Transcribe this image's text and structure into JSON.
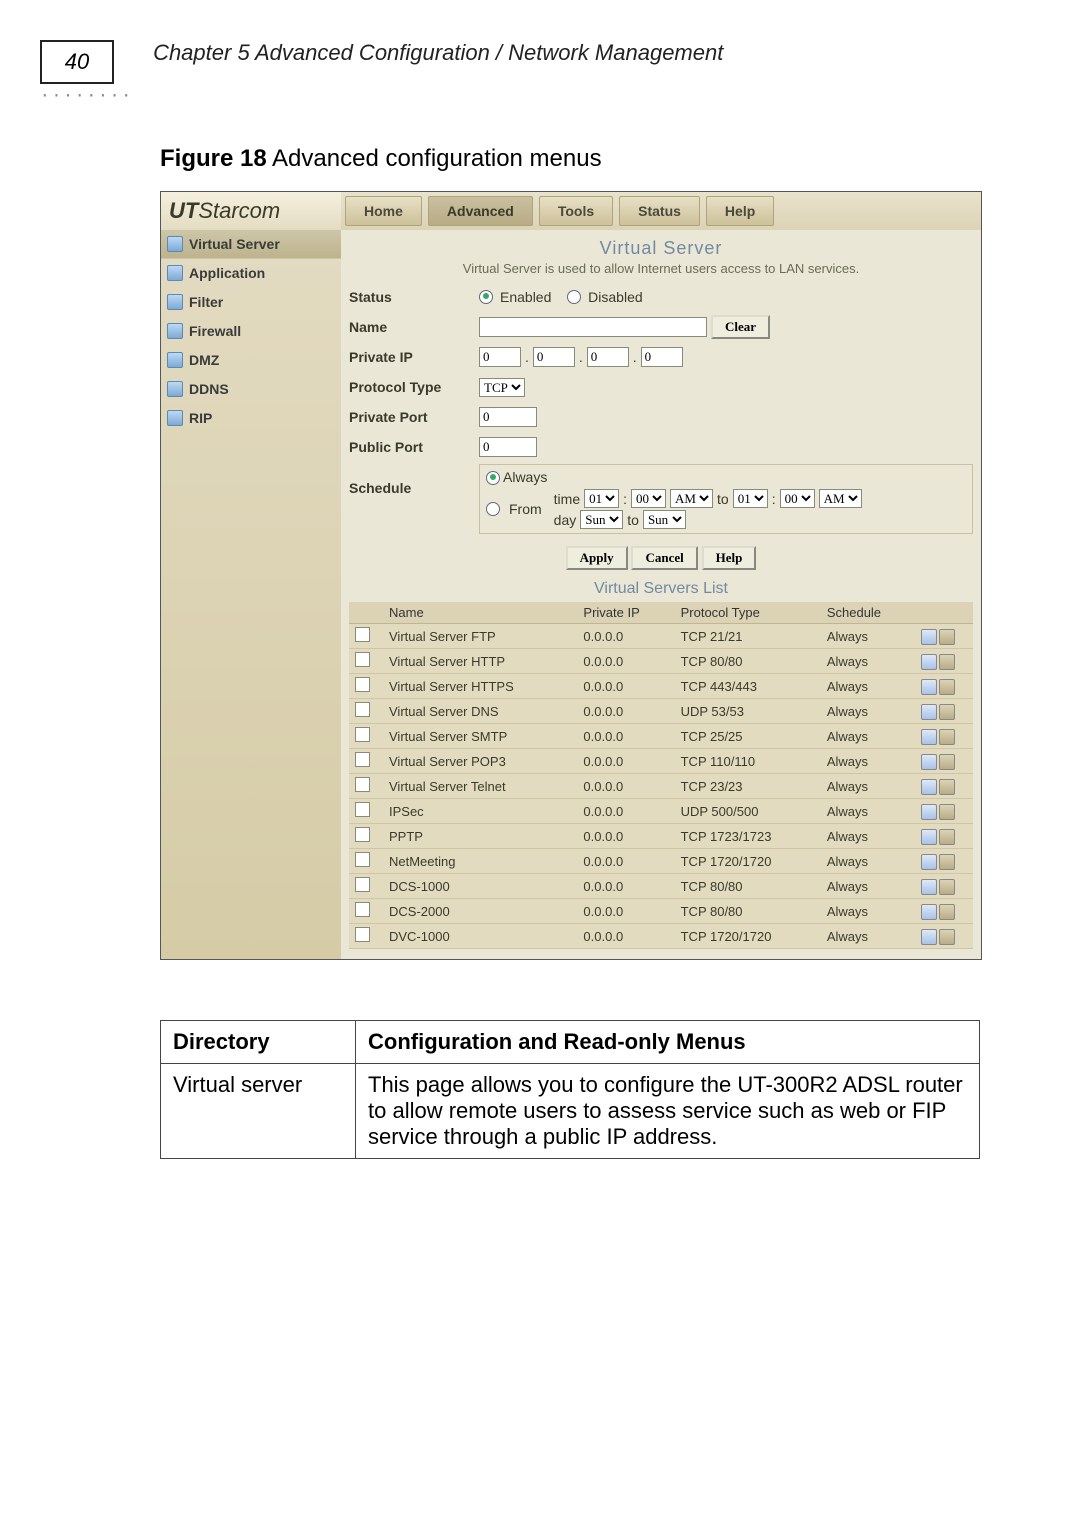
{
  "page_number": "40",
  "chapter_title": "Chapter 5 Advanced Configuration / Network Management",
  "figure_caption_prefix": "Figure 18",
  "figure_caption_rest": " Advanced configuration menus",
  "brand_bold": "UT",
  "brand_rest": "Starcom",
  "tabs": {
    "home": "Home",
    "advanced": "Advanced",
    "tools": "Tools",
    "status": "Status",
    "help": "Help"
  },
  "sidebar": {
    "virtual_server": "Virtual Server",
    "application": "Application",
    "filter": "Filter",
    "firewall": "Firewall",
    "dmz": "DMZ",
    "ddns": "DDNS",
    "rip": "RIP"
  },
  "section_title": "Virtual Server",
  "section_note": "Virtual Server is used to allow Internet users access to LAN services.",
  "labels": {
    "status": "Status",
    "enabled": "Enabled",
    "disabled": "Disabled",
    "name": "Name",
    "clear": "Clear",
    "private_ip": "Private IP",
    "protocol_type": "Protocol Type",
    "protocol_value": "TCP",
    "private_port": "Private Port",
    "public_port": "Public Port",
    "schedule": "Schedule",
    "always": "Always",
    "from": "From",
    "time": "time",
    "day": "day",
    "to": "to",
    "hr1": "01",
    "mn1": "00",
    "ampm1": "AM",
    "hr2": "01",
    "mn2": "00",
    "ampm2": "AM",
    "day1": "Sun",
    "day2": "Sun"
  },
  "ip": {
    "a": "0",
    "b": "0",
    "c": "0",
    "d": "0"
  },
  "ports": {
    "private": "0",
    "public": "0"
  },
  "buttons": {
    "apply": "Apply",
    "cancel": "Cancel",
    "help": "Help"
  },
  "list_title": "Virtual Servers List",
  "list_headers": {
    "name": "Name",
    "ip": "Private IP",
    "proto": "Protocol Type",
    "sched": "Schedule"
  },
  "rows": [
    {
      "name": "Virtual Server FTP",
      "ip": "0.0.0.0",
      "proto": "TCP 21/21",
      "sched": "Always"
    },
    {
      "name": "Virtual Server HTTP",
      "ip": "0.0.0.0",
      "proto": "TCP 80/80",
      "sched": "Always"
    },
    {
      "name": "Virtual Server HTTPS",
      "ip": "0.0.0.0",
      "proto": "TCP 443/443",
      "sched": "Always"
    },
    {
      "name": "Virtual Server DNS",
      "ip": "0.0.0.0",
      "proto": "UDP 53/53",
      "sched": "Always"
    },
    {
      "name": "Virtual Server SMTP",
      "ip": "0.0.0.0",
      "proto": "TCP 25/25",
      "sched": "Always"
    },
    {
      "name": "Virtual Server POP3",
      "ip": "0.0.0.0",
      "proto": "TCP 110/110",
      "sched": "Always"
    },
    {
      "name": "Virtual Server Telnet",
      "ip": "0.0.0.0",
      "proto": "TCP 23/23",
      "sched": "Always"
    },
    {
      "name": "IPSec",
      "ip": "0.0.0.0",
      "proto": "UDP 500/500",
      "sched": "Always"
    },
    {
      "name": "PPTP",
      "ip": "0.0.0.0",
      "proto": "TCP 1723/1723",
      "sched": "Always"
    },
    {
      "name": "NetMeeting",
      "ip": "0.0.0.0",
      "proto": "TCP 1720/1720",
      "sched": "Always"
    },
    {
      "name": "DCS-1000",
      "ip": "0.0.0.0",
      "proto": "TCP 80/80",
      "sched": "Always"
    },
    {
      "name": "DCS-2000",
      "ip": "0.0.0.0",
      "proto": "TCP 80/80",
      "sched": "Always"
    },
    {
      "name": "DVC-1000",
      "ip": "0.0.0.0",
      "proto": "TCP 1720/1720",
      "sched": "Always"
    }
  ],
  "doc_table": {
    "h1": "Directory",
    "h2": "Configuration and Read-only Menus",
    "r1c1": "Virtual server",
    "r1c2": "This page allows you to configure the UT-300R2 ADSL router to allow remote users to assess service such as web or FIP service through a public IP address."
  }
}
